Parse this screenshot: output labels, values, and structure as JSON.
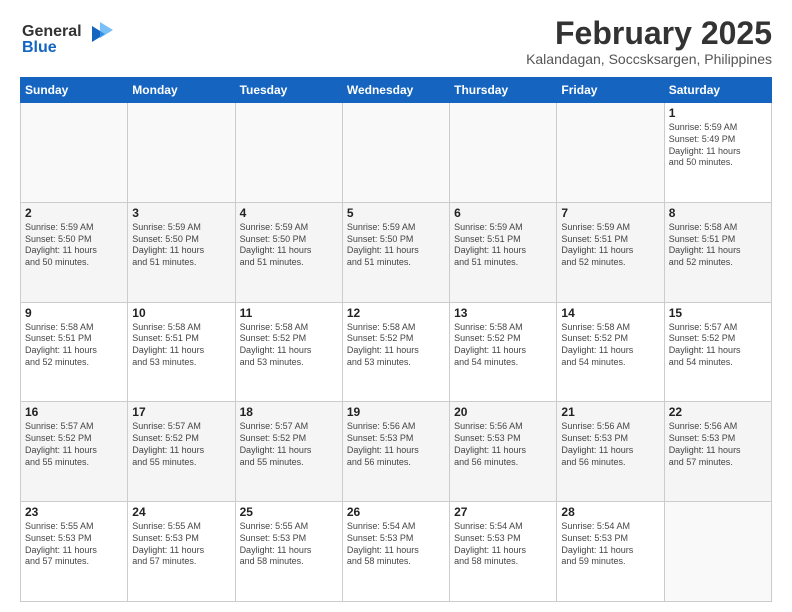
{
  "logo": {
    "line1": "General",
    "line2": "Blue"
  },
  "title": "February 2025",
  "subtitle": "Kalandagan, Soccsksargen, Philippines",
  "weekdays": [
    "Sunday",
    "Monday",
    "Tuesday",
    "Wednesday",
    "Thursday",
    "Friday",
    "Saturday"
  ],
  "weeks": [
    [
      {
        "day": "",
        "info": ""
      },
      {
        "day": "",
        "info": ""
      },
      {
        "day": "",
        "info": ""
      },
      {
        "day": "",
        "info": ""
      },
      {
        "day": "",
        "info": ""
      },
      {
        "day": "",
        "info": ""
      },
      {
        "day": "1",
        "info": "Sunrise: 5:59 AM\nSunset: 5:49 PM\nDaylight: 11 hours\nand 50 minutes."
      }
    ],
    [
      {
        "day": "2",
        "info": "Sunrise: 5:59 AM\nSunset: 5:50 PM\nDaylight: 11 hours\nand 50 minutes."
      },
      {
        "day": "3",
        "info": "Sunrise: 5:59 AM\nSunset: 5:50 PM\nDaylight: 11 hours\nand 51 minutes."
      },
      {
        "day": "4",
        "info": "Sunrise: 5:59 AM\nSunset: 5:50 PM\nDaylight: 11 hours\nand 51 minutes."
      },
      {
        "day": "5",
        "info": "Sunrise: 5:59 AM\nSunset: 5:50 PM\nDaylight: 11 hours\nand 51 minutes."
      },
      {
        "day": "6",
        "info": "Sunrise: 5:59 AM\nSunset: 5:51 PM\nDaylight: 11 hours\nand 51 minutes."
      },
      {
        "day": "7",
        "info": "Sunrise: 5:59 AM\nSunset: 5:51 PM\nDaylight: 11 hours\nand 52 minutes."
      },
      {
        "day": "8",
        "info": "Sunrise: 5:58 AM\nSunset: 5:51 PM\nDaylight: 11 hours\nand 52 minutes."
      }
    ],
    [
      {
        "day": "9",
        "info": "Sunrise: 5:58 AM\nSunset: 5:51 PM\nDaylight: 11 hours\nand 52 minutes."
      },
      {
        "day": "10",
        "info": "Sunrise: 5:58 AM\nSunset: 5:51 PM\nDaylight: 11 hours\nand 53 minutes."
      },
      {
        "day": "11",
        "info": "Sunrise: 5:58 AM\nSunset: 5:52 PM\nDaylight: 11 hours\nand 53 minutes."
      },
      {
        "day": "12",
        "info": "Sunrise: 5:58 AM\nSunset: 5:52 PM\nDaylight: 11 hours\nand 53 minutes."
      },
      {
        "day": "13",
        "info": "Sunrise: 5:58 AM\nSunset: 5:52 PM\nDaylight: 11 hours\nand 54 minutes."
      },
      {
        "day": "14",
        "info": "Sunrise: 5:58 AM\nSunset: 5:52 PM\nDaylight: 11 hours\nand 54 minutes."
      },
      {
        "day": "15",
        "info": "Sunrise: 5:57 AM\nSunset: 5:52 PM\nDaylight: 11 hours\nand 54 minutes."
      }
    ],
    [
      {
        "day": "16",
        "info": "Sunrise: 5:57 AM\nSunset: 5:52 PM\nDaylight: 11 hours\nand 55 minutes."
      },
      {
        "day": "17",
        "info": "Sunrise: 5:57 AM\nSunset: 5:52 PM\nDaylight: 11 hours\nand 55 minutes."
      },
      {
        "day": "18",
        "info": "Sunrise: 5:57 AM\nSunset: 5:52 PM\nDaylight: 11 hours\nand 55 minutes."
      },
      {
        "day": "19",
        "info": "Sunrise: 5:56 AM\nSunset: 5:53 PM\nDaylight: 11 hours\nand 56 minutes."
      },
      {
        "day": "20",
        "info": "Sunrise: 5:56 AM\nSunset: 5:53 PM\nDaylight: 11 hours\nand 56 minutes."
      },
      {
        "day": "21",
        "info": "Sunrise: 5:56 AM\nSunset: 5:53 PM\nDaylight: 11 hours\nand 56 minutes."
      },
      {
        "day": "22",
        "info": "Sunrise: 5:56 AM\nSunset: 5:53 PM\nDaylight: 11 hours\nand 57 minutes."
      }
    ],
    [
      {
        "day": "23",
        "info": "Sunrise: 5:55 AM\nSunset: 5:53 PM\nDaylight: 11 hours\nand 57 minutes."
      },
      {
        "day": "24",
        "info": "Sunrise: 5:55 AM\nSunset: 5:53 PM\nDaylight: 11 hours\nand 57 minutes."
      },
      {
        "day": "25",
        "info": "Sunrise: 5:55 AM\nSunset: 5:53 PM\nDaylight: 11 hours\nand 58 minutes."
      },
      {
        "day": "26",
        "info": "Sunrise: 5:54 AM\nSunset: 5:53 PM\nDaylight: 11 hours\nand 58 minutes."
      },
      {
        "day": "27",
        "info": "Sunrise: 5:54 AM\nSunset: 5:53 PM\nDaylight: 11 hours\nand 58 minutes."
      },
      {
        "day": "28",
        "info": "Sunrise: 5:54 AM\nSunset: 5:53 PM\nDaylight: 11 hours\nand 59 minutes."
      },
      {
        "day": "",
        "info": ""
      }
    ]
  ]
}
